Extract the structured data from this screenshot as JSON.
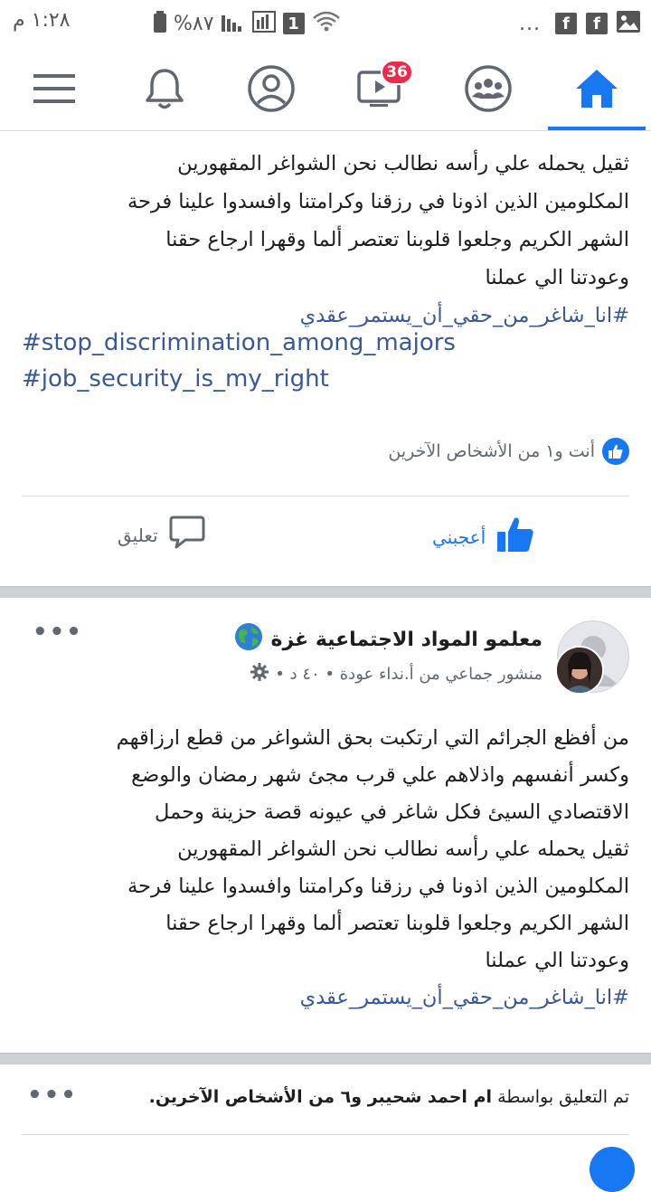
{
  "status_bar": {
    "time": "١:٢٨ م",
    "battery": "%٨٧",
    "sim_label": "1",
    "overflow": "..."
  },
  "nav": {
    "badge_count": "36",
    "items": [
      "menu-icon",
      "bell-icon",
      "profile-icon",
      "watch-icon",
      "groups-icon",
      "home-icon"
    ],
    "active": "home"
  },
  "post1": {
    "lines": [
      "ثقيل يحمله علي رأسه نطالب نحن الشواغر المقهورين",
      "المكلومين الذين اذونا في رزقنا وكرامتنا وافسدوا علينا فرحة",
      "الشهر الكريم وجلعوا قلوبنا تعتصر ألما وقهرا ارجاع حقنا",
      "وعودتنا الي عملنا"
    ],
    "hashtag_ar": "#انا_شاغر_من_حقي_أن_يستمر_عقدي",
    "hashtag_en1": "#stop_discrimination_among_majors",
    "hashtag_en2": "#job_security_is_my_right",
    "reactions_text": "أنت و١ من الأشخاص الآخرين",
    "like_label": "أعجبني",
    "comment_label": "تعليق"
  },
  "post2": {
    "group_name": "معلمو المواد الاجتماعية غزة",
    "meta": "منشور جماعي من أ.نداء عودة • ٤٠ د •",
    "more": "•••",
    "lines": [
      "من أفظع الجرائم التي ارتكبت بحق الشواغر من قطع ارزاقهم",
      "وكسر أنفسهم واذلاهم علي قرب مجئ شهر رمضان والوضع",
      "الاقتصادي السيئ فكل شاغر في عيونه قصة حزينة وحمل",
      "ثقيل يحمله علي رأسه نطالب نحن الشواغر المقهورين",
      "المكلومين الذين اذونا في رزقنا وكرامتنا وافسدوا علينا فرحة",
      "الشهر الكريم وجلعوا قلوبنا تعتصر ألما وقهرا ارجاع حقنا",
      "وعودتنا الي عملنا"
    ],
    "hashtag_ar": "#انا_شاغر_من_حقي_أن_يستمر_عقدي"
  },
  "notification": {
    "prefix": "تم التعليق بواسطة",
    "bold": "ام احمد شحيبر و٦ من الأشخاص الآخرين.",
    "more": "•••"
  },
  "colors": {
    "facebook_blue": "#1877f2",
    "hashtag": "#385898",
    "badge": "#f02849"
  }
}
